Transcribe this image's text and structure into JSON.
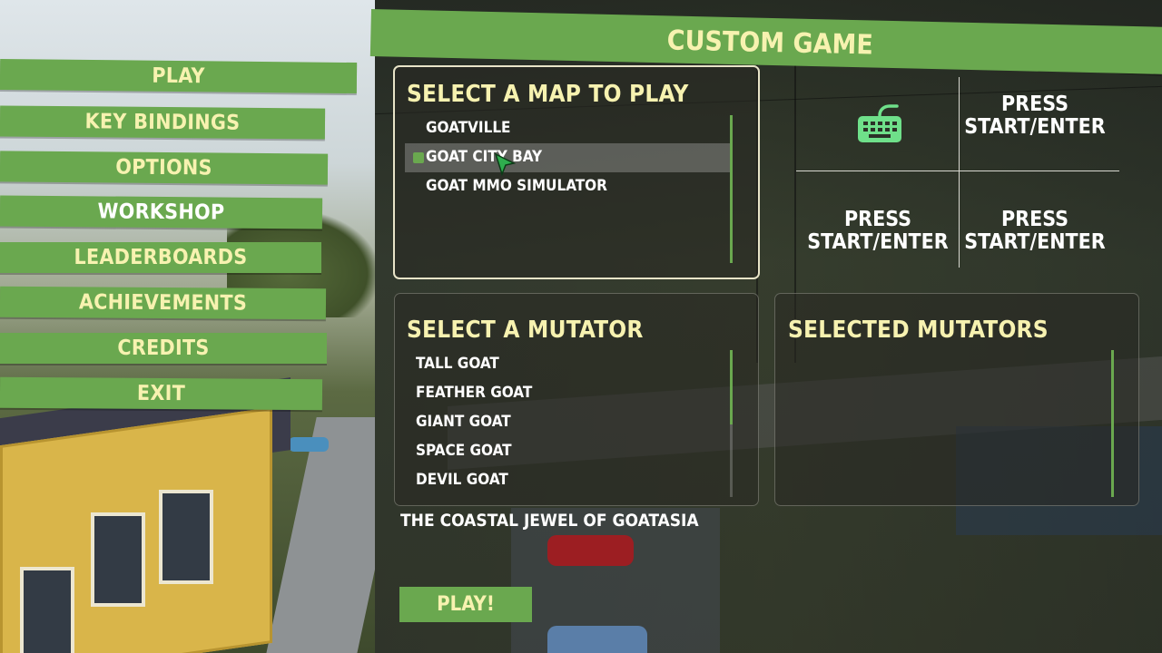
{
  "header": {
    "title": "CUSTOM GAME"
  },
  "menu": [
    {
      "label": "PLAY"
    },
    {
      "label": "KEY BINDINGS"
    },
    {
      "label": "OPTIONS"
    },
    {
      "label": "WORKSHOP"
    },
    {
      "label": "LEADERBOARDS"
    },
    {
      "label": "ACHIEVEMENTS"
    },
    {
      "label": "CREDITS"
    },
    {
      "label": "EXIT"
    }
  ],
  "map_select": {
    "title": "SELECT A MAP TO PLAY",
    "maps": [
      "GOATVILLE",
      "GOAT CITY BAY",
      "GOAT MMO SIMULATOR"
    ],
    "selected": "GOAT CITY BAY"
  },
  "mutator_select": {
    "title": "SELECT A MUTATOR",
    "mutators": [
      "TALL GOAT",
      "FEATHER GOAT",
      "GIANT GOAT",
      "SPACE GOAT",
      "DEVIL GOAT"
    ]
  },
  "selected_mutators": {
    "title": "SELECTED MUTATORS",
    "items": []
  },
  "players": {
    "slot1_icon": "keyboard-icon",
    "slot2": "PRESS START/ENTER",
    "slot3": "PRESS START/ENTER",
    "slot4": "PRESS START/ENTER"
  },
  "description": "THE COASTAL JEWEL OF GOATASIA",
  "play_button": "PLAY!",
  "colors": {
    "accent_green": "#6aa84f",
    "title_yellow": "#f7f2b0",
    "keyboard_green": "#6fe08a"
  }
}
